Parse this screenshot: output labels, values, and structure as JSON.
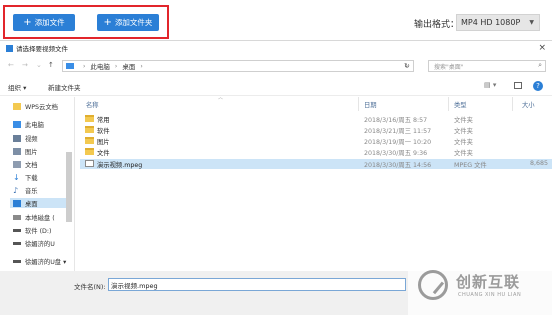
{
  "toolbar": {
    "add_file_label": "添加文件",
    "add_folder_label": "添加文件夹",
    "output_format_label": "输出格式：",
    "output_format_value": "MP4  HD 1080P",
    "accent_color": "#2b7fd6",
    "highlight_color": "#e2252b"
  },
  "dialog": {
    "title": "请选择要视频文件",
    "close_glyph": "×",
    "breadcrumb": [
      "此电脑",
      "桌面"
    ],
    "search_placeholder": "搜索\"桌面\"",
    "organize_label": "组织 ▾",
    "new_folder_label": "新建文件夹",
    "help_glyph": "?"
  },
  "sidebar": {
    "items": [
      {
        "label": "WPS云文档",
        "icon": "folder-icon"
      },
      {
        "label": "此电脑",
        "icon": "computer-icon"
      },
      {
        "label": "视频",
        "icon": "video-library-icon"
      },
      {
        "label": "图片",
        "icon": "picture-library-icon"
      },
      {
        "label": "文档",
        "icon": "document-library-icon"
      },
      {
        "label": "下载",
        "icon": "download-icon"
      },
      {
        "label": "音乐",
        "icon": "music-icon"
      },
      {
        "label": "桌面",
        "icon": "desktop-icon",
        "selected": true
      },
      {
        "label": "本地磁盘 (",
        "icon": "drive-icon"
      },
      {
        "label": "软件 (D:)",
        "icon": "drive-icon"
      },
      {
        "label": "徐媚济的U",
        "icon": "usb-icon"
      },
      {
        "label": "徐媚济的U盘 ▾",
        "icon": "usb-icon"
      }
    ]
  },
  "file_list": {
    "columns": {
      "name": "名称",
      "date": "日期",
      "type": "类型",
      "size": "大小"
    },
    "rows": [
      {
        "name": "常用",
        "date": "2018/3/16/周五 8:57",
        "type": "文件夹",
        "size": "",
        "kind": "folder"
      },
      {
        "name": "软件",
        "date": "2018/3/21/周三 11:57",
        "type": "文件夹",
        "size": "",
        "kind": "folder"
      },
      {
        "name": "图片",
        "date": "2018/3/19/周一 10:20",
        "type": "文件夹",
        "size": "",
        "kind": "folder"
      },
      {
        "name": "文件",
        "date": "2018/3/30/周五 9:36",
        "type": "文件夹",
        "size": "",
        "kind": "folder"
      },
      {
        "name": "演示视频.mpeg",
        "date": "2018/3/30/周五 14:56",
        "type": "MPEG 文件",
        "size": "8,685",
        "kind": "video",
        "selected": true
      }
    ]
  },
  "bottom": {
    "filename_label": "文件名(N):",
    "filename_value": "演示视频.mpeg"
  },
  "watermark": {
    "text_cn": "创新互联",
    "text_en": "CHUANG XIN HU LIAN"
  }
}
